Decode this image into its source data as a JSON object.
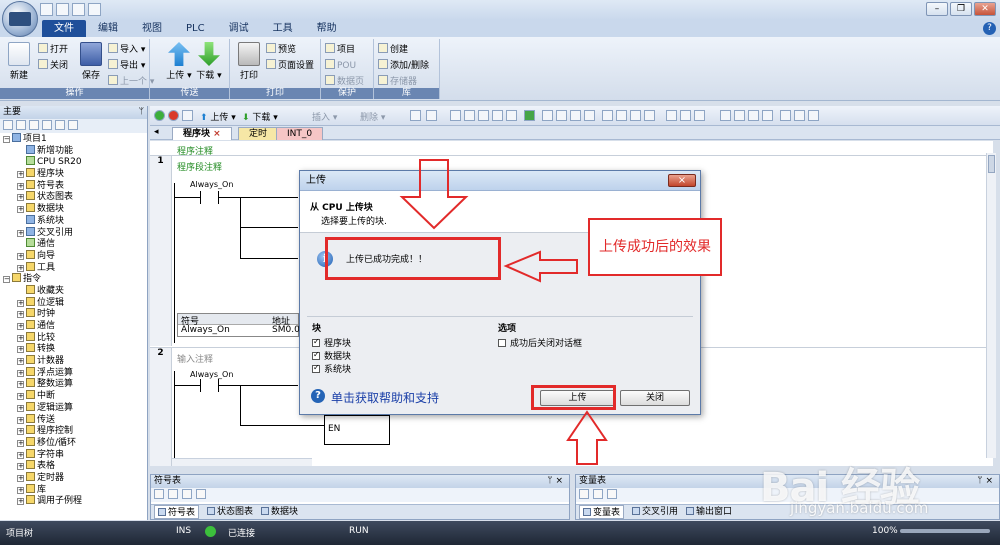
{
  "menu": {
    "items": [
      "文件",
      "编辑",
      "视图",
      "PLC",
      "调试",
      "工具",
      "帮助"
    ],
    "active_index": 0
  },
  "ribbon": {
    "groups": [
      {
        "name": "操作",
        "new": "新建",
        "open": "打开",
        "close": "关闭",
        "save": "保存",
        "import": "导入",
        "export": "导出",
        "prev": "上一个"
      },
      {
        "name": "传送",
        "upload": "上传",
        "download": "下载"
      },
      {
        "name": "打印",
        "print": "打印",
        "preview": "预览",
        "page_setup": "页面设置"
      },
      {
        "name": "保护",
        "project": "项目",
        "pou": "POU",
        "data_page": "数据页"
      },
      {
        "name": "库",
        "create": "创建",
        "add_remove": "添加/删除",
        "memory": "存储器"
      }
    ]
  },
  "left_panel": {
    "title": "主要",
    "tree": [
      {
        "label": "项目1",
        "level": 0,
        "pm": "−",
        "icon": "blue"
      },
      {
        "label": "新增功能",
        "level": 1,
        "pm": "",
        "icon": "blue"
      },
      {
        "label": "CPU SR20",
        "level": 1,
        "pm": "",
        "icon": "green"
      },
      {
        "label": "程序块",
        "level": 1,
        "pm": "+",
        "icon": ""
      },
      {
        "label": "符号表",
        "level": 1,
        "pm": "+",
        "icon": ""
      },
      {
        "label": "状态图表",
        "level": 1,
        "pm": "+",
        "icon": ""
      },
      {
        "label": "数据块",
        "level": 1,
        "pm": "+",
        "icon": ""
      },
      {
        "label": "系统块",
        "level": 1,
        "pm": "",
        "icon": "blue"
      },
      {
        "label": "交叉引用",
        "level": 1,
        "pm": "+",
        "icon": "blue"
      },
      {
        "label": "通信",
        "level": 1,
        "pm": "",
        "icon": "green"
      },
      {
        "label": "向导",
        "level": 1,
        "pm": "+",
        "icon": ""
      },
      {
        "label": "工具",
        "level": 1,
        "pm": "+",
        "icon": ""
      },
      {
        "label": "指令",
        "level": 0,
        "pm": "−",
        "icon": ""
      },
      {
        "label": "收藏夹",
        "level": 1,
        "pm": "",
        "icon": ""
      },
      {
        "label": "位逻辑",
        "level": 1,
        "pm": "+",
        "icon": ""
      },
      {
        "label": "时钟",
        "level": 1,
        "pm": "+",
        "icon": ""
      },
      {
        "label": "通信",
        "level": 1,
        "pm": "+",
        "icon": ""
      },
      {
        "label": "比较",
        "level": 1,
        "pm": "+",
        "icon": ""
      },
      {
        "label": "转换",
        "level": 1,
        "pm": "+",
        "icon": ""
      },
      {
        "label": "计数器",
        "level": 1,
        "pm": "+",
        "icon": ""
      },
      {
        "label": "浮点运算",
        "level": 1,
        "pm": "+",
        "icon": ""
      },
      {
        "label": "整数运算",
        "level": 1,
        "pm": "+",
        "icon": ""
      },
      {
        "label": "中断",
        "level": 1,
        "pm": "+",
        "icon": ""
      },
      {
        "label": "逻辑运算",
        "level": 1,
        "pm": "+",
        "icon": ""
      },
      {
        "label": "传送",
        "level": 1,
        "pm": "+",
        "icon": ""
      },
      {
        "label": "程序控制",
        "level": 1,
        "pm": "+",
        "icon": ""
      },
      {
        "label": "移位/循环",
        "level": 1,
        "pm": "+",
        "icon": ""
      },
      {
        "label": "字符串",
        "level": 1,
        "pm": "+",
        "icon": ""
      },
      {
        "label": "表格",
        "level": 1,
        "pm": "+",
        "icon": ""
      },
      {
        "label": "定时器",
        "level": 1,
        "pm": "+",
        "icon": ""
      },
      {
        "label": "库",
        "level": 1,
        "pm": "+",
        "icon": ""
      },
      {
        "label": "调用子例程",
        "level": 1,
        "pm": "+",
        "icon": ""
      }
    ]
  },
  "toolbar2": {
    "upload": "上传",
    "download": "下载",
    "insert": "插入",
    "delete": "删除"
  },
  "tabs": [
    "程序块",
    "定时",
    "INT_0"
  ],
  "ladder": {
    "program_comment": "程序注释",
    "network1": {
      "num": "1",
      "comment": "程序段注释",
      "contact": "Always_On",
      "sym_head_symbol": "符号",
      "sym_head_address": "地址",
      "sym_row_symbol": "Always_On",
      "sym_row_address": "SM0.0"
    },
    "network2": {
      "num": "2",
      "comment": "输入注释",
      "contact": "Always_On",
      "en": "EN"
    }
  },
  "bottom_left": {
    "title": "符号表",
    "tabs": [
      "符号表",
      "状态图表",
      "数据块"
    ]
  },
  "bottom_right": {
    "title": "变量表",
    "tabs": [
      "变量表",
      "交叉引用",
      "输出窗口"
    ]
  },
  "statusbar": {
    "project_tree": "项目树",
    "ins": "INS",
    "connected": "已连接",
    "run": "RUN",
    "zoom": "100%"
  },
  "dialog": {
    "title": "上传",
    "close_glyph": "×",
    "header_title": "从 CPU 上传块",
    "header_sub": "选择要上传的块.",
    "message": "上传已成功完成！！",
    "blocks_title": "块",
    "blocks": [
      {
        "label": "程序块",
        "checked": true
      },
      {
        "label": "数据块",
        "checked": true
      },
      {
        "label": "系统块",
        "checked": true
      }
    ],
    "options_title": "选项",
    "option_close": {
      "label": "成功后关闭对话框",
      "checked": false
    },
    "help_text": "单击获取帮助和支持",
    "upload_button": "上传",
    "close_button": "关闭"
  },
  "annotation": {
    "callout_text": "上传成功后的效果",
    "color": "#e22a2a"
  },
  "watermark": {
    "brand": "Bai 经验",
    "url": "jingyan.baidu.com"
  }
}
